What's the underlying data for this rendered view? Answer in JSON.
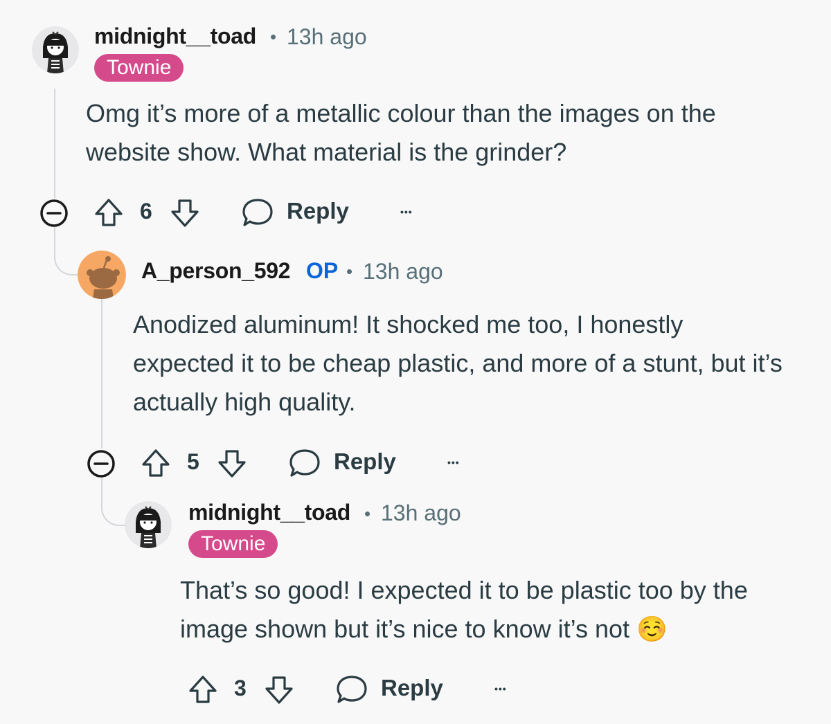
{
  "comments": [
    {
      "author": "midnight__toad",
      "separator": "•",
      "time": "13h ago",
      "flair": "Townie",
      "body": "Omg it’s more of a metallic colour than the images on the website show. What material is the grinder?",
      "votes": "6",
      "reply_label": "Reply",
      "more_label": "•••"
    },
    {
      "author": "A_person_592",
      "op_badge": "OP",
      "separator": "•",
      "time": "13h ago",
      "body": "Anodized aluminum! It shocked me too, I honestly expected it to be cheap plastic, and more of a stunt, but it’s actually high quality.",
      "votes": "5",
      "reply_label": "Reply",
      "more_label": "•••"
    },
    {
      "author": "midnight__toad",
      "separator": "•",
      "time": "13h ago",
      "flair": "Townie",
      "body": "That’s so good! I expected it to be plastic too by the image shown but it’s nice to know it’s not",
      "emoji": "☺️",
      "votes": "3",
      "reply_label": "Reply",
      "more_label": "•••"
    }
  ],
  "colors": {
    "background": "#f8f8f9",
    "flair": "#d54a8b",
    "op_badge": "#0a65d8",
    "meta_text": "#576f76",
    "body_text": "#2a3c42",
    "thread_line": "#d3d6da",
    "snoo_avatar_bg": "#f5a763"
  }
}
